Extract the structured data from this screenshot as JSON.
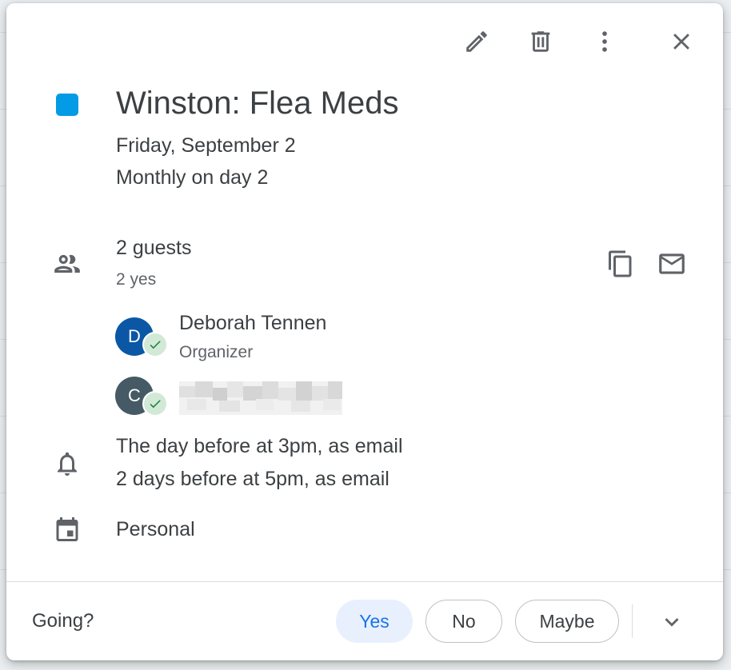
{
  "colors": {
    "event": "#039be5",
    "avatar_d": "#0b57a6",
    "avatar_c": "#455a64",
    "accent": "#1a73e8",
    "check": "#188038"
  },
  "toolbar": {
    "edit_icon": "edit-icon",
    "delete_icon": "delete-icon",
    "more_icon": "more-vert-icon",
    "close_icon": "close-icon"
  },
  "event": {
    "title": "Winston: Flea Meds",
    "date": "Friday, September 2",
    "recurrence": "Monthly on day 2"
  },
  "guests": {
    "count_label": "2 guests",
    "summary": "2 yes",
    "list": [
      {
        "initial": "D",
        "name": "Deborah Tennen",
        "role": "Organizer"
      },
      {
        "initial": "C"
      }
    ]
  },
  "reminders": [
    "The day before at 3pm, as email",
    "2 days before at 5pm, as email"
  ],
  "calendar": {
    "name": "Personal"
  },
  "footer": {
    "going_label": "Going?",
    "yes": "Yes",
    "no": "No",
    "maybe": "Maybe"
  }
}
